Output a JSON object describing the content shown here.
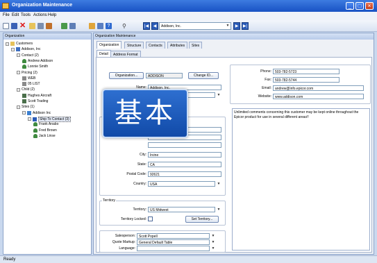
{
  "window": {
    "title": "Organization Maintenance"
  },
  "menu": [
    "File",
    "Edit",
    "Tools",
    "Actions",
    "Help"
  ],
  "toolbar": {
    "combo_value": "Addison, Inc.",
    "icons": [
      "new-icon",
      "save-icon",
      "delete-icon",
      "open-icon",
      "print-icon",
      "edit-icon",
      "refresh-icon",
      "cut-icon",
      "copy-icon",
      "paste-icon",
      "help-icon",
      "find-icon"
    ]
  },
  "left_panel": {
    "header": "Organization",
    "tree": [
      {
        "label": "Customers",
        "level": 0,
        "exp": "−",
        "icon": "folder-icon"
      },
      {
        "label": "Addison, Inc",
        "level": 1,
        "exp": "−",
        "icon": "company-icon"
      },
      {
        "label": "Contact (2)",
        "level": 2,
        "exp": "−",
        "icon": ""
      },
      {
        "label": "Andrew Addison",
        "level": 3,
        "exp": "",
        "icon": "person-icon"
      },
      {
        "label": "Lonnie Smith",
        "level": 3,
        "exp": "",
        "icon": "person-icon"
      },
      {
        "label": "Pricing (2)",
        "level": 2,
        "exp": "−",
        "icon": ""
      },
      {
        "label": "WEB",
        "level": 3,
        "exp": "",
        "icon": "price-icon"
      },
      {
        "label": "05 LIST",
        "level": 3,
        "exp": "",
        "icon": "price-icon"
      },
      {
        "label": "Child (2)",
        "level": 2,
        "exp": "−",
        "icon": ""
      },
      {
        "label": "Hughes Aircraft",
        "level": 3,
        "exp": "",
        "icon": "plane-icon"
      },
      {
        "label": "Scott Trading",
        "level": 3,
        "exp": "",
        "icon": "plane-icon"
      },
      {
        "label": "Sites (1)",
        "level": 2,
        "exp": "−",
        "icon": ""
      },
      {
        "label": "Addison Inc",
        "level": 3,
        "exp": "−",
        "icon": "globe-icon"
      },
      {
        "label": "Ship To Contact (3)",
        "level": 4,
        "exp": "−",
        "icon": "ship-icon"
      },
      {
        "label": "Frank Anabo",
        "level": 5,
        "exp": "",
        "icon": "person-icon"
      },
      {
        "label": "Fred Brown",
        "level": 5,
        "exp": "",
        "icon": "person-icon"
      },
      {
        "label": "Jack Linse",
        "level": 5,
        "exp": "",
        "icon": "person-icon"
      }
    ]
  },
  "right_panel": {
    "header": "Organization Maintenance",
    "tabs": [
      "Organization",
      "Structure",
      "Contacts",
      "Attributes",
      "Sites"
    ],
    "subtabs": [
      "Detail",
      "Address Format"
    ],
    "organization_btn": "Organization...",
    "org_id": "ADDISON",
    "change_id_btn": "Change ID...",
    "name_label": "Name:",
    "name_value": "Addison, Inc.",
    "city_label": "City:",
    "city_value": "Irvine",
    "state_label": "State:",
    "state_value": "CA",
    "postal_label": "Postal Code:",
    "postal_value": "92621",
    "country_label": "Country:",
    "country_value": "USA",
    "territory_group": "Territory",
    "territory_label": "Territory:",
    "territory_value": "US Midwest",
    "territory_locked_label": "Territory Locked:",
    "set_territory_btn": "Set Territory...",
    "salesperson_label": "Salesperson:",
    "salesperson_value": "Scott Popell",
    "quote_markup_label": "Quote Markup:",
    "quote_markup_value": "General Default Table",
    "language_label": "Language:",
    "language_value": "",
    "phone_label": "Phone:",
    "phone_value": "503-782-5723",
    "fax_label": "Fax:",
    "fax_value": "503-782-5744",
    "email_label": "Email:",
    "email_value": "andrew@info.epicor.com",
    "website_label": "Website:",
    "website_value": "www.addison.com",
    "comments": "Unlimited comments concerning this customer may be kept online throughout the Epicor product for use in several different areas!!"
  },
  "overlay_text": "基本",
  "status": "Ready"
}
